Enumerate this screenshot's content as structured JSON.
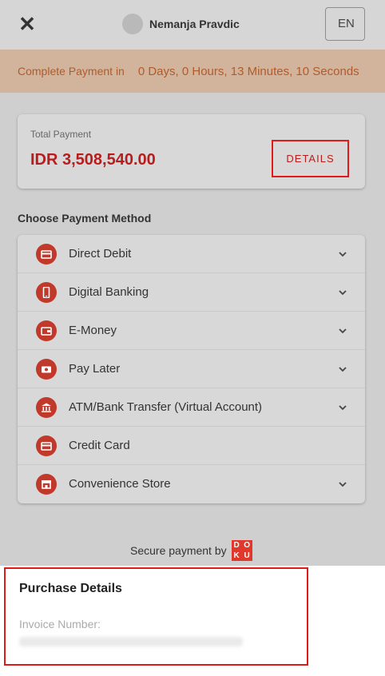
{
  "header": {
    "close_icon": "close-icon",
    "user_name": "Nemanja Pravdic",
    "language": "EN"
  },
  "countdown": {
    "label": "Complete Payment in",
    "value": "0 Days, 0 Hours, 13 Minutes, 10 Seconds"
  },
  "total": {
    "label": "Total Payment",
    "amount": "IDR 3,508,540.00",
    "details_label": "DETAILS"
  },
  "payment_methods": {
    "title": "Choose Payment Method",
    "items": [
      {
        "label": "Direct Debit",
        "icon": "card-icon",
        "expandable": true
      },
      {
        "label": "Digital Banking",
        "icon": "phone-icon",
        "expandable": true
      },
      {
        "label": "E-Money",
        "icon": "wallet-icon",
        "expandable": true
      },
      {
        "label": "Pay Later",
        "icon": "cash-icon",
        "expandable": true
      },
      {
        "label": "ATM/Bank Transfer (Virtual Account)",
        "icon": "bank-icon",
        "expandable": true
      },
      {
        "label": "Credit Card",
        "icon": "card-icon",
        "expandable": false
      },
      {
        "label": "Convenience Store",
        "icon": "store-icon",
        "expandable": true
      }
    ]
  },
  "footer": {
    "secure_text": "Secure payment by",
    "logo_letters": [
      "D",
      "O",
      "K",
      "U"
    ]
  },
  "purchase": {
    "title": "Purchase Details",
    "invoice_label": "Invoice Number:"
  },
  "colors": {
    "accent_red": "#c0392b",
    "amount_red": "#b81d1d",
    "highlight_red": "#e01919",
    "countdown_bg": "#d2b49c",
    "countdown_text": "#b35a2a"
  }
}
